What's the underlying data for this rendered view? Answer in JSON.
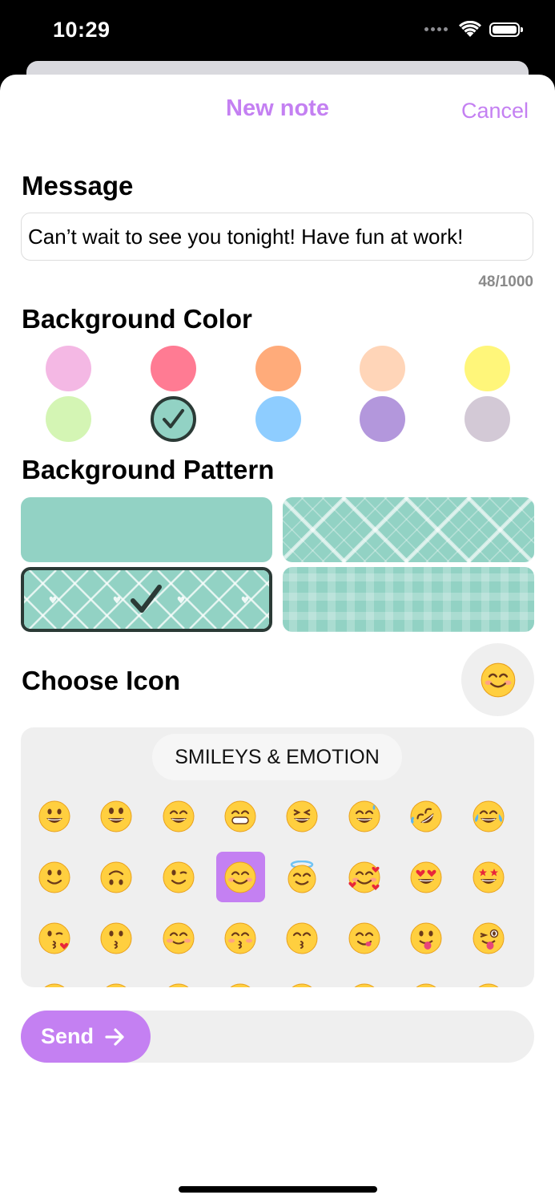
{
  "status_bar": {
    "time": "10:29",
    "icons": [
      "cellular-signal-icon",
      "wifi-icon",
      "battery-icon"
    ]
  },
  "nav": {
    "title": "New note",
    "cancel_label": "Cancel"
  },
  "message": {
    "section_label": "Message",
    "value": "Can’t wait to see you tonight! Have fun at work!",
    "char_count": "48/1000"
  },
  "background_color": {
    "section_label": "Background Color",
    "options": [
      "#f4b8e4",
      "#ff7b93",
      "#ffab7a",
      "#ffd5b8",
      "#fff67a",
      "#d4f5b4",
      "#92d2c4",
      "#8ecdff",
      "#b397dc",
      "#d3c9d6"
    ],
    "selected_index": 6
  },
  "background_pattern": {
    "section_label": "Background Pattern",
    "options": [
      "solid",
      "lattice",
      "hearts-lattice",
      "plaid"
    ],
    "selected_index": 2,
    "base_color": "#92d2c4"
  },
  "icon": {
    "section_label": "Choose Icon",
    "selected": "smiling-face-with-smiling-eyes",
    "category_label": "SMILEYS & EMOTION",
    "emojis": [
      "grinning-face",
      "grinning-face-big-eyes",
      "grinning-face-smiling-eyes",
      "beaming-face",
      "grinning-squinting-face",
      "grinning-face-sweat",
      "rolling-on-floor-laughing",
      "tears-of-joy",
      "slightly-smiling-face",
      "upside-down-face",
      "winking-face",
      "smiling-face-with-smiling-eyes",
      "smiling-face-with-halo",
      "smiling-face-with-hearts",
      "heart-eyes",
      "star-struck",
      "face-blowing-kiss",
      "kissing-face",
      "smiling-face",
      "kissing-face-closed-eyes",
      "kissing-face-smiling-eyes",
      "face-savoring-food",
      "face-with-tongue",
      "winking-face-with-tongue"
    ],
    "selected_emoji_index": 11
  },
  "send": {
    "label": "Send"
  },
  "colors": {
    "accent": "#c480f2",
    "sheet": "#ffffff",
    "panel": "#efefef",
    "emoji_yellow": "#ffcf3f"
  }
}
